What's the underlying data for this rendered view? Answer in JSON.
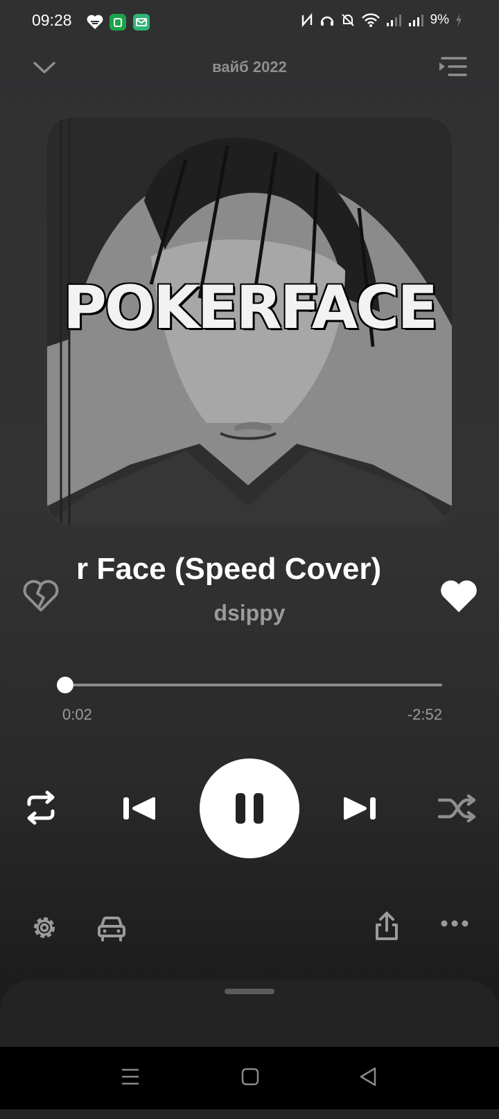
{
  "status_bar": {
    "time": "09:28",
    "battery": "9%",
    "icons": [
      "heart-icon",
      "shopping-app-icon",
      "mail-app-icon",
      "nfc-icon",
      "headphones-icon",
      "mute-icon",
      "wifi-icon",
      "signal-icon",
      "signal-icon",
      "battery-charging-icon"
    ]
  },
  "header": {
    "title": "вайб 2022"
  },
  "cover": {
    "text": "POKERFACE"
  },
  "track": {
    "title": "r Face (Speed Cover)",
    "artist": "dsippy",
    "liked": true
  },
  "progress": {
    "elapsed": "0:02",
    "remaining": "-2:52",
    "fraction": 0.0115
  },
  "controls": {
    "state": "playing",
    "icons": [
      "repeat-icon",
      "previous-icon",
      "pause-icon",
      "next-icon",
      "shuffle-icon"
    ]
  },
  "bottom_actions": [
    "settings-icon",
    "car-icon",
    "share-icon",
    "more-icon"
  ],
  "colors": {
    "background": "#303031",
    "accent": "#ffffff",
    "muted": "#9b9b9c"
  }
}
